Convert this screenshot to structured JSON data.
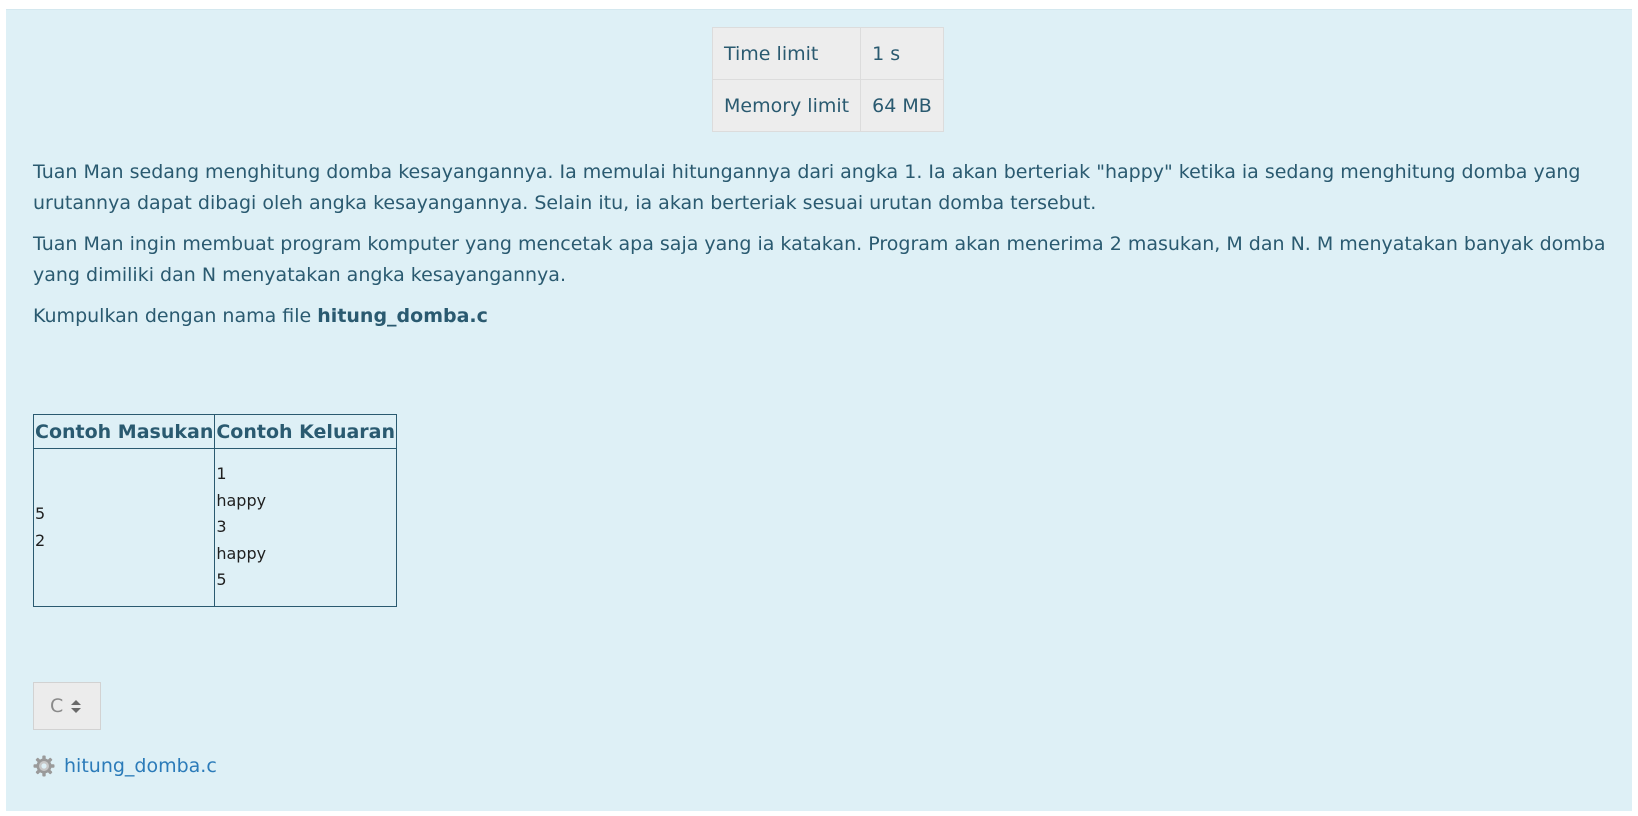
{
  "limits": {
    "time_label": "Time limit",
    "time_value": "1 s",
    "memory_label": "Memory limit",
    "memory_value": "64 MB"
  },
  "description": {
    "paragraph1": "Tuan Man sedang menghitung domba kesayangannya. Ia memulai hitungannya dari angka 1. Ia akan berteriak \"happy\" ketika ia sedang menghitung domba yang urutannya dapat dibagi oleh angka kesayangannya. Selain itu, ia akan berteriak sesuai urutan domba tersebut.",
    "paragraph2": "Tuan Man ingin membuat program komputer yang mencetak apa saja yang ia katakan. Program akan menerima 2 masukan, M dan N. M menyatakan banyak domba yang dimiliki dan N menyatakan angka kesayangannya.",
    "submit_prefix": "Kumpulkan dengan nama file ",
    "submit_filename": "hitung_domba.c"
  },
  "samples": {
    "input_header": "Contoh Masukan",
    "output_header": "Contoh Keluaran",
    "input_lines": [
      "5",
      "2"
    ],
    "output_lines": [
      "1",
      "happy",
      "3",
      "happy",
      "5"
    ]
  },
  "language_select": {
    "selected": "C"
  },
  "file_link": {
    "icon": "gear-icon",
    "label": "hitung_domba.c"
  },
  "colors": {
    "panel_bg": "#def0f6",
    "text": "#2a5a70",
    "link": "#2b7bb9"
  }
}
